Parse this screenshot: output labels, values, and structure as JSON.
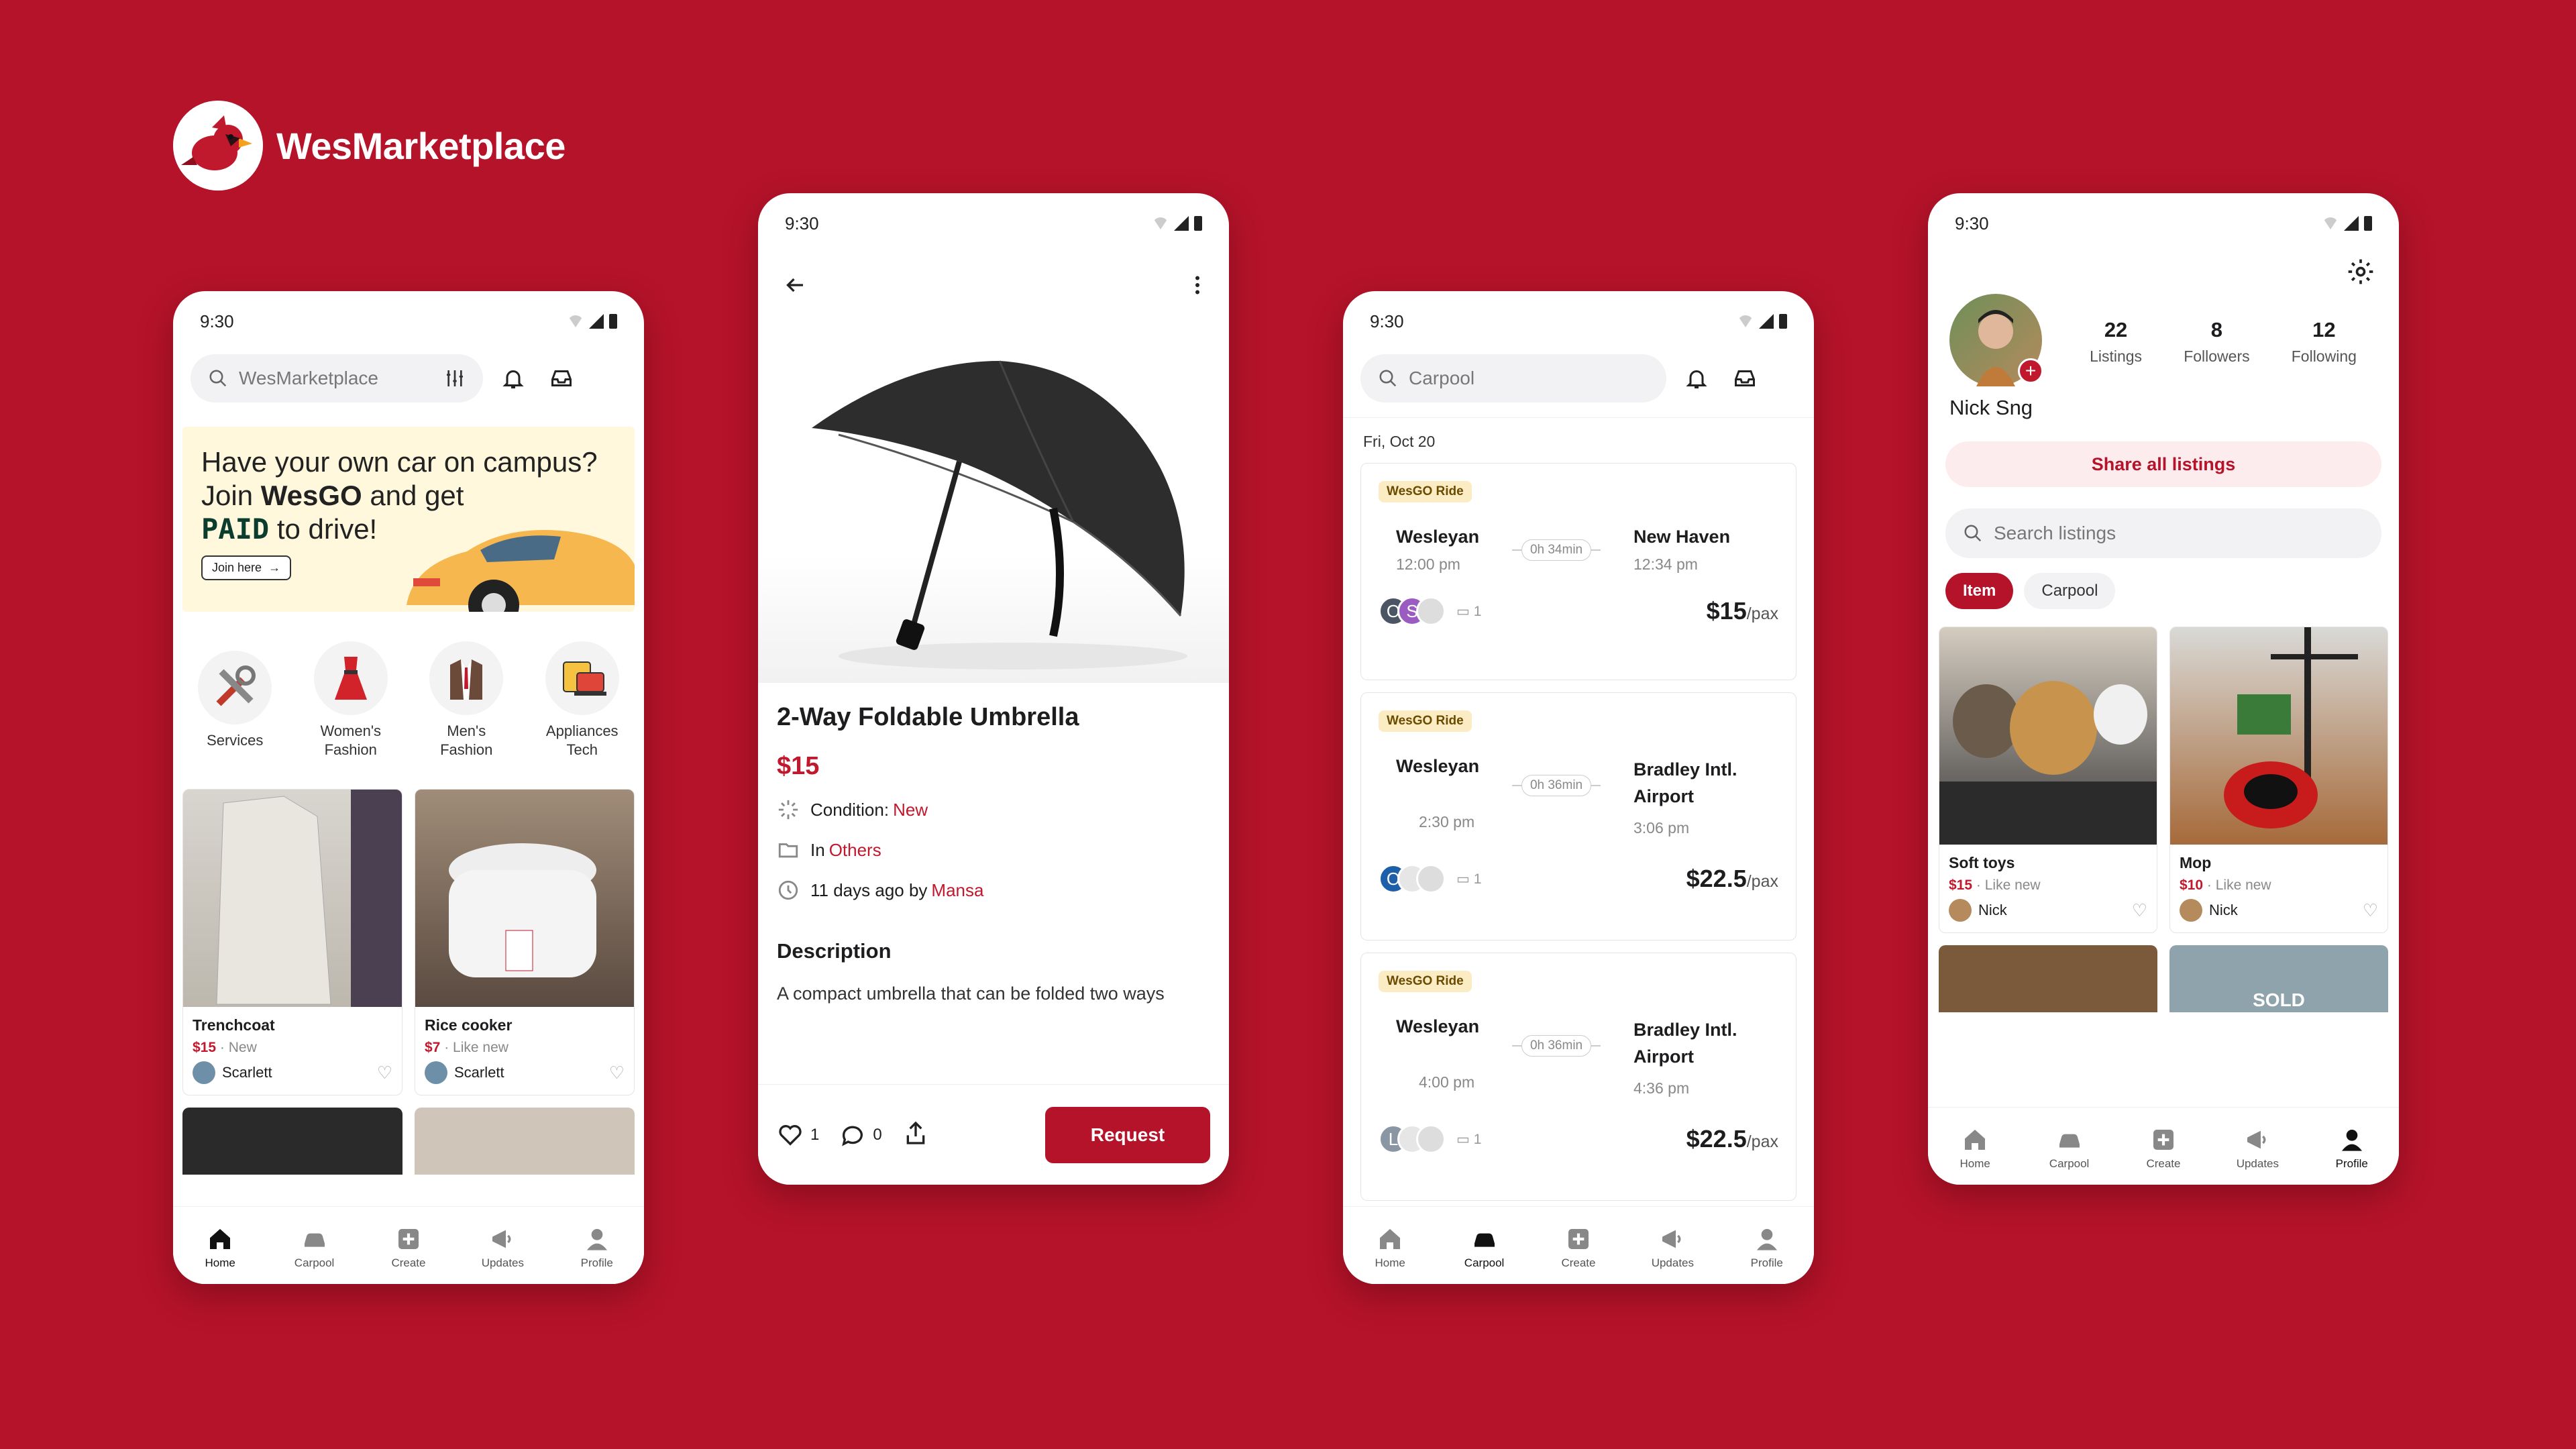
{
  "brand": {
    "name": "WesMarketplace"
  },
  "status": {
    "time": "9:30"
  },
  "tabs": [
    "Home",
    "Carpool",
    "Create",
    "Updates",
    "Profile"
  ],
  "home": {
    "search_placeholder": "WesMarketplace",
    "banner": {
      "line1": "Have your own car on campus?",
      "line2a": "Join ",
      "line2b": "WesGO",
      "line2c": " and get",
      "line3a": "PAID",
      "line3b": " to drive!",
      "cta": "Join here"
    },
    "categories": [
      {
        "label1": "Services",
        "label2": ""
      },
      {
        "label1": "Women's",
        "label2": "Fashion"
      },
      {
        "label1": "Men's",
        "label2": "Fashion"
      },
      {
        "label1": "Appliances",
        "label2": "Tech"
      }
    ],
    "listings": [
      {
        "title": "Trenchcoat",
        "price": "$15",
        "condition": "New",
        "seller": "Scarlett"
      },
      {
        "title": "Rice cooker",
        "price": "$7",
        "condition": "Like new",
        "seller": "Scarlett"
      }
    ]
  },
  "detail": {
    "title": "2-Way Foldable Umbrella",
    "price": "$15",
    "condition_label": "Condition: ",
    "condition_value": "New",
    "category_label": "In ",
    "category_value": "Others",
    "posted_label": "11 days ago by ",
    "posted_by": "Mansa",
    "description_heading": "Description",
    "description_text": "A compact umbrella that can be folded two ways",
    "likes": "1",
    "comments": "0",
    "request_label": "Request"
  },
  "carpool": {
    "search_placeholder": "Carpool",
    "date": "Fri, Oct 20",
    "rides": [
      {
        "badge": "WesGO Ride",
        "from": "Wesleyan",
        "from_time": "12:00 pm",
        "duration": "0h 34min",
        "to1": "New Haven",
        "to2": "",
        "to_time": "12:34 pm",
        "seats": "1",
        "price": "$15",
        "unit": "/pax",
        "riders": [
          "O",
          "S"
        ]
      },
      {
        "badge": "WesGO Ride",
        "from": "Wesleyan",
        "from_time": "2:30 pm",
        "duration": "0h 36min",
        "to1": "Bradley Intl.",
        "to2": "Airport",
        "to_time": "3:06 pm",
        "seats": "1",
        "price": "$22.5",
        "unit": "/pax",
        "riders": [
          "O"
        ]
      },
      {
        "badge": "WesGO Ride",
        "from": "Wesleyan",
        "from_time": "4:00 pm",
        "duration": "0h 36min",
        "to1": "Bradley Intl.",
        "to2": "Airport",
        "to_time": "4:36 pm",
        "seats": "1",
        "price": "$22.5",
        "unit": "/pax",
        "riders": [
          "L"
        ]
      }
    ]
  },
  "profile": {
    "name": "Nick Sng",
    "listings_count": "22",
    "listings_label": "Listings",
    "followers_count": "8",
    "followers_label": "Followers",
    "following_count": "12",
    "following_label": "Following",
    "share_label": "Share all listings",
    "search_placeholder": "Search listings",
    "filter_item": "Item",
    "filter_carpool": "Carpool",
    "listings": [
      {
        "title": "Soft toys",
        "price": "$15",
        "condition": "Like new",
        "seller": "Nick"
      },
      {
        "title": "Mop",
        "price": "$10",
        "condition": "Like new",
        "seller": "Nick"
      }
    ],
    "sold_label": "SOLD"
  },
  "colors": {
    "brand": "#b5132a",
    "accent": "#c0182d"
  }
}
